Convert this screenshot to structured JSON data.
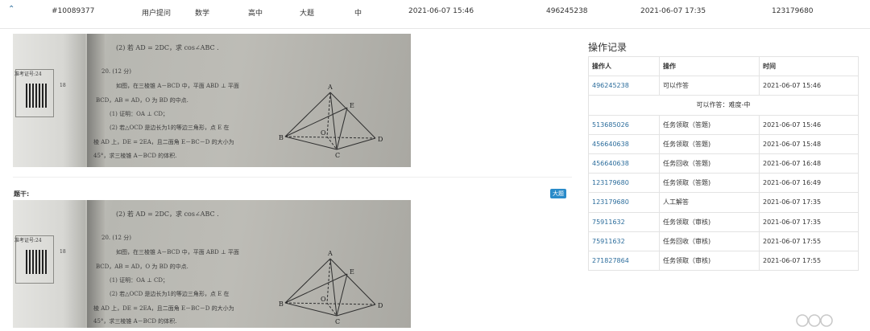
{
  "summary": {
    "id": "#10089377",
    "source": "用户提问",
    "subject": "数学",
    "grade": "高中",
    "qtype": "大题",
    "difficulty": "中",
    "created": "2021-06-07 15:46",
    "user": "496245238",
    "finished": "2021-06-07 17:35",
    "handler": "123179680"
  },
  "stem_label": "题干:",
  "type_badge": "大题",
  "photo": {
    "line1": "(2) 若 AD = 2DC，求 cos∠ABC .",
    "line2": "20. (12 分)",
    "line3": "如图，在三棱锥 A－BCD 中，平面 ABD ⊥ 平面",
    "line4": "BCD，AB = AD，O 为 BD 的中点.",
    "line5": "(1) 证明：OA ⊥ CD；",
    "line6": "(2) 若△OCD 是边长为1的等边三角形，点 E 在",
    "line7": "棱 AD 上，DE = 2EA，且二面角 E－BC－D 的大小为",
    "line8": "45°，求三棱锥 A－BCD 的体积.",
    "stub_label": "准考证号:24",
    "page_num": "18",
    "pts": {
      "a": "A",
      "b": "B",
      "c": "C",
      "d": "D",
      "e": "E",
      "o": "O"
    }
  },
  "log_panel": {
    "title": "操作记录",
    "headers": [
      "操作人",
      "操作",
      "时间"
    ],
    "rows": [
      {
        "operator": "496245238",
        "action": "可以作答",
        "time": "2021-06-07 15:46"
      },
      {
        "note": "可以作答：难度-中"
      },
      {
        "operator": "513685026",
        "action": "任务领取（答题)",
        "time": "2021-06-07 15:46"
      },
      {
        "operator": "456640638",
        "action": "任务领取（答题)",
        "time": "2021-06-07 15:48"
      },
      {
        "operator": "456640638",
        "action": "任务回收（答题)",
        "time": "2021-06-07 16:48"
      },
      {
        "operator": "123179680",
        "action": "任务领取（答题)",
        "time": "2021-06-07 16:49"
      },
      {
        "operator": "123179680",
        "action": "人工解答",
        "time": "2021-06-07 17:35"
      },
      {
        "operator": "75911632",
        "action": "任务领取（审核)",
        "time": "2021-06-07 17:35"
      },
      {
        "operator": "75911632",
        "action": "任务回收（审核)",
        "time": "2021-06-07 17:55"
      },
      {
        "operator": "271827864",
        "action": "任务领取（审核)",
        "time": "2021-06-07 17:55"
      }
    ]
  }
}
